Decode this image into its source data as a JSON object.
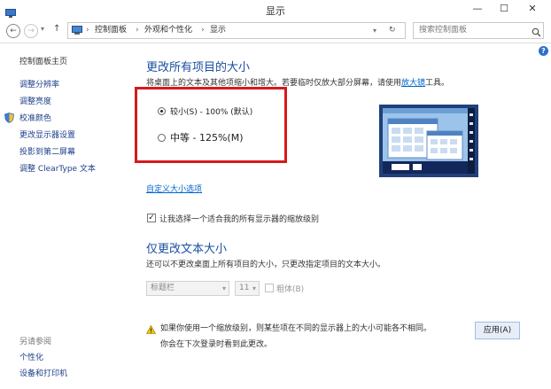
{
  "window": {
    "title": "显示",
    "minimize": "—",
    "maximize": "☐",
    "close": "✕"
  },
  "nav": {
    "back": "←",
    "forward": "→",
    "up": "↑",
    "breadcrumb": [
      "控制面板",
      "外观和个性化",
      "显示"
    ],
    "separator": "›",
    "refresh": "↻",
    "search_placeholder": "搜索控制面板",
    "help": "?"
  },
  "sidebar": {
    "items": [
      {
        "label": "控制面板主页"
      },
      {
        "label": "调整分辨率"
      },
      {
        "label": "调整亮度"
      },
      {
        "label": "校准颜色"
      },
      {
        "label": "更改显示器设置"
      },
      {
        "label": "投影到第二屏幕"
      },
      {
        "label": "调整 ClearType 文本"
      }
    ],
    "see_also": "另请参阅",
    "see_also_items": [
      {
        "label": "个性化"
      },
      {
        "label": "设备和打印机"
      }
    ]
  },
  "main": {
    "heading1": "更改所有项目的大小",
    "desc1_prefix": "将桌面上的文本及其他项缩小和增大。若要临时仅放大部分屏幕，请使用",
    "desc1_link": "放大镜",
    "desc1_suffix": "工具。",
    "option_small": "较小(S) - 100% (默认)",
    "option_medium": "中等 - 125%(M)",
    "custom_link": "自定义大小选项",
    "checkbox_label": "让我选择一个适合我的所有显示器的缩放级别",
    "heading2": "仅更改文本大小",
    "desc2": "还可以不更改桌面上所有项目的大小，只更改指定项目的文本大小。",
    "element_select": "标题栏",
    "size_select": "11",
    "bold_label": "粗体(B)",
    "warning_line1": "如果你使用一个缩放级别，则某些项在不同的显示器上的大小可能各不相同。",
    "warning_line2": "你会在下次登录时看到此更改。",
    "apply": "应用(A)"
  },
  "colors": {
    "accent": "#1a4fa0",
    "highlight_box": "#d51a1a"
  }
}
